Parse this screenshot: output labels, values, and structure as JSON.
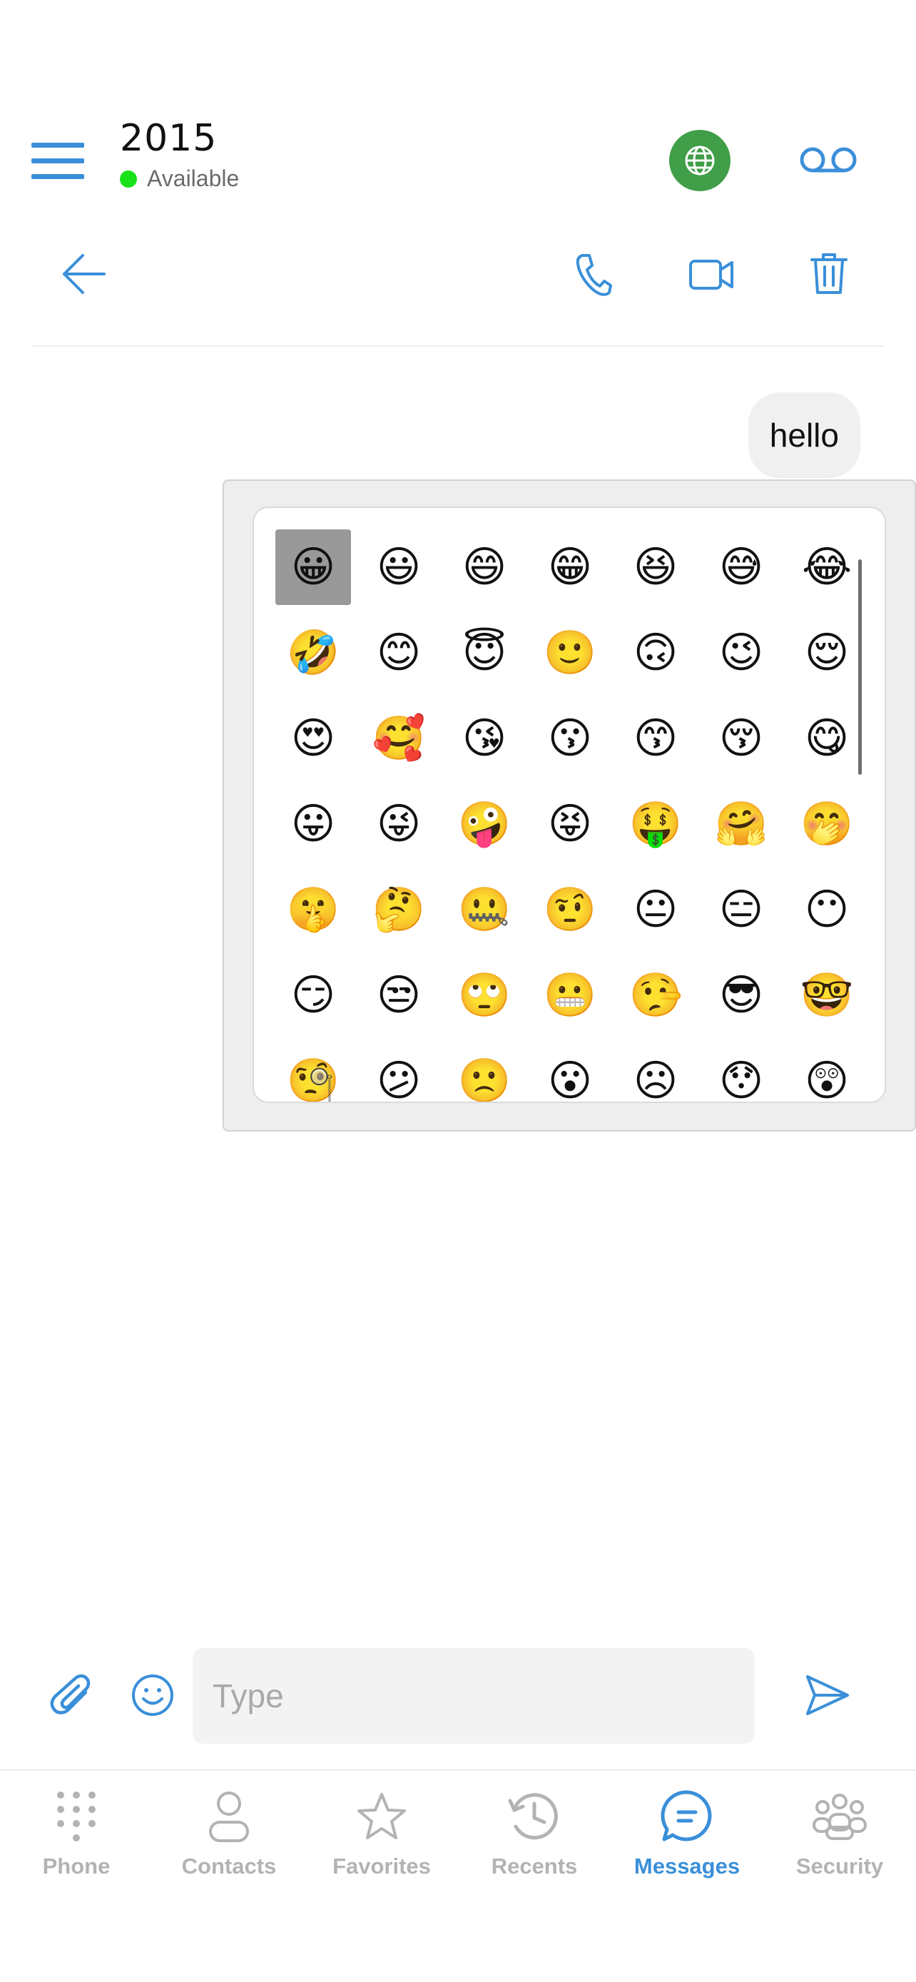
{
  "header": {
    "title": "2015",
    "status_text": "Available",
    "status_color": "#18e218",
    "icons": [
      "hamburger-menu-icon",
      "globe-icon",
      "voicemail-icon"
    ],
    "globe_bg_color": "#3f9e47"
  },
  "toolbar": {
    "icons": [
      "arrow-left-icon",
      "phone-icon",
      "video-camera-icon",
      "trash-icon"
    ]
  },
  "messages": [
    {
      "text": "hello",
      "direction": "outgoing"
    }
  ],
  "emoji_picker": {
    "selected_index": 0,
    "emojis": [
      "😀",
      "😃",
      "😄",
      "😁",
      "😆",
      "😅",
      "😂",
      "🤣",
      "😊",
      "😇",
      "🙂",
      "🙃",
      "😉",
      "😌",
      "😍",
      "🥰",
      "😘",
      "😗",
      "😙",
      "😚",
      "😋",
      "😛",
      "😜",
      "🤪",
      "😝",
      "🤑",
      "🤗",
      "🤭",
      "🤫",
      "🤔",
      "🤐",
      "🤨",
      "😐",
      "😑",
      "😶",
      "😏",
      "😒",
      "🙄",
      "😬",
      "🤥",
      "😎",
      "🤓",
      "🧐",
      "😕",
      "🙁",
      "😮",
      "☹",
      "😯",
      "😲"
    ]
  },
  "composer": {
    "placeholder": "Type",
    "value": "",
    "icons": [
      "paperclip-icon",
      "smiley-icon",
      "send-icon"
    ]
  },
  "tabs": [
    {
      "label": "Phone",
      "icon": "dialpad-icon",
      "active": false
    },
    {
      "label": "Contacts",
      "icon": "person-icon",
      "active": false
    },
    {
      "label": "Favorites",
      "icon": "star-icon",
      "active": false
    },
    {
      "label": "Recents",
      "icon": "history-clock-icon",
      "active": false
    },
    {
      "label": "Messages",
      "icon": "chat-bubble-icon",
      "active": true
    },
    {
      "label": "Security",
      "icon": "group-icon",
      "active": false
    }
  ],
  "colors": {
    "accent": "#3a8fd9",
    "inactive": "#b3b3b3"
  }
}
